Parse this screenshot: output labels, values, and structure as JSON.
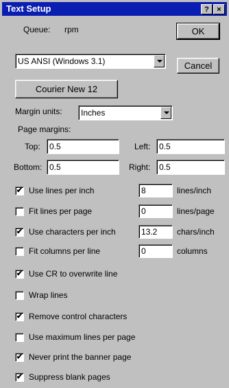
{
  "title": "Text Setup",
  "title_buttons": {
    "help": "?",
    "close": "×"
  },
  "queue_label": "Queue:",
  "queue_value": "rpm",
  "buttons": {
    "ok": "OK",
    "cancel": "Cancel",
    "font": "Courier New 12"
  },
  "driver_select": {
    "value": "US ANSI (Windows 3.1)"
  },
  "margin_units": {
    "label": "Margin units:",
    "value": "Inches"
  },
  "page_margins": {
    "heading": "Page margins:",
    "top": {
      "label": "Top:",
      "value": "0.5"
    },
    "left": {
      "label": "Left:",
      "value": "0.5"
    },
    "bottom": {
      "label": "Bottom:",
      "value": "0.5"
    },
    "right": {
      "label": "Right:",
      "value": "0.5"
    }
  },
  "options": [
    {
      "label": "Use lines per inch",
      "checked": true,
      "value": "8",
      "unit": "lines/inch"
    },
    {
      "label": "Fit lines per page",
      "checked": false,
      "value": "0",
      "unit": "lines/page"
    },
    {
      "label": "Use characters per inch",
      "checked": true,
      "value": "13.2",
      "unit": "chars/inch"
    },
    {
      "label": "Fit columns per line",
      "checked": false,
      "value": "0",
      "unit": "columns"
    },
    {
      "label": "Use CR to overwrite line",
      "checked": true
    },
    {
      "label": "Wrap lines",
      "checked": false
    },
    {
      "label": "Remove control characters",
      "checked": true
    },
    {
      "label": "Use maximum lines per page",
      "checked": false
    },
    {
      "label": "Never print the banner page",
      "checked": true
    },
    {
      "label": "Suppress blank pages",
      "checked": true
    }
  ],
  "check_mark": "✔"
}
